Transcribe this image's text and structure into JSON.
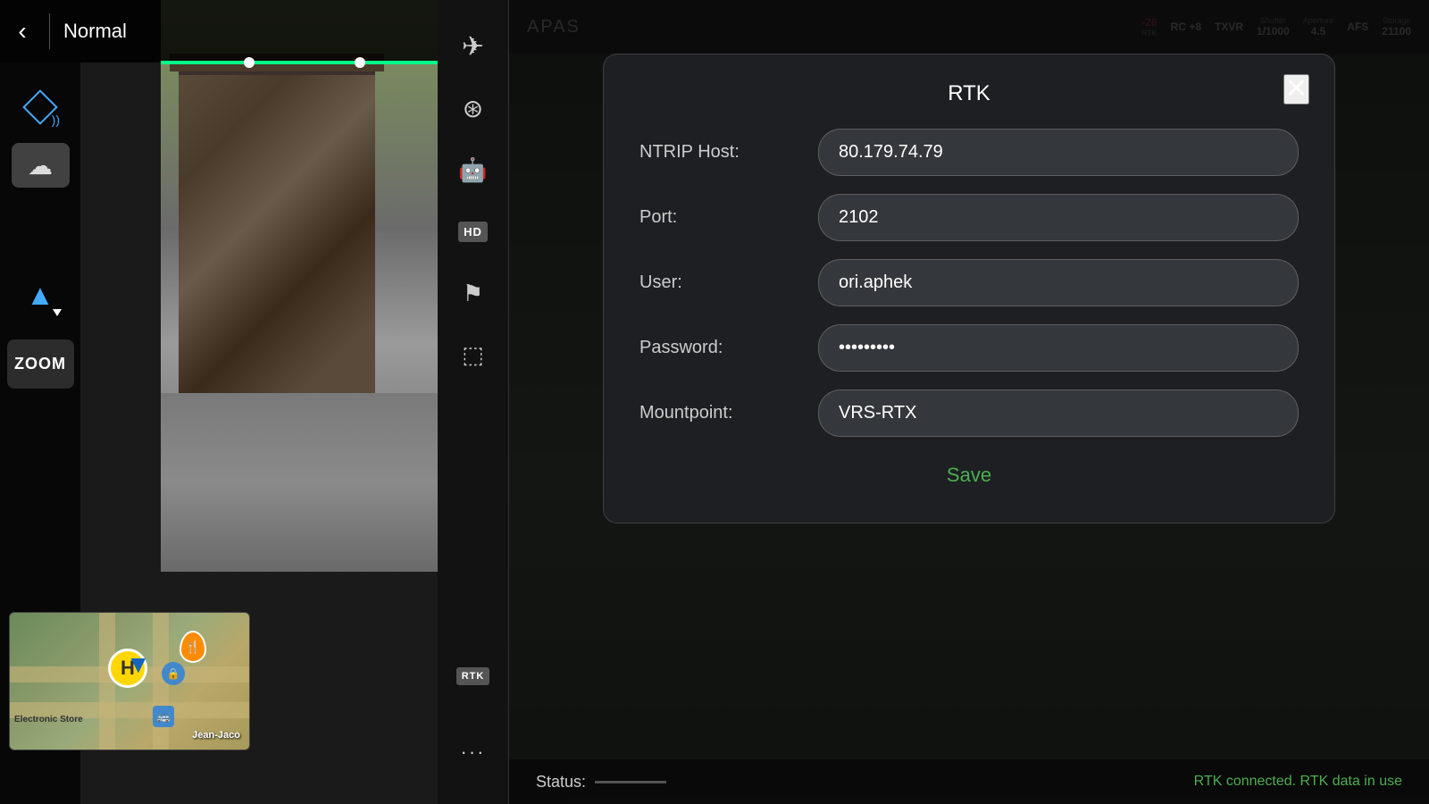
{
  "topbar": {
    "back_label": "‹",
    "mode_label": "Normal"
  },
  "sidebar_left": {
    "zoom_label": "ZOOM"
  },
  "apas_bar": {
    "apas_label": "APAS"
  },
  "top_status": {
    "items": [
      {
        "label": "RTK",
        "value": "-28",
        "color": "red"
      },
      {
        "label": "RC",
        "value": "+8",
        "color": "normal"
      },
      {
        "label": "TXVR",
        "value": "",
        "color": "normal"
      },
      {
        "label": "Shutter",
        "value": "1/1000",
        "color": "normal"
      },
      {
        "label": "Aperture",
        "value": "4.5",
        "color": "normal"
      },
      {
        "label": "AFS",
        "value": "",
        "color": "normal"
      },
      {
        "label": "Storage",
        "value": "21100",
        "color": "normal"
      }
    ]
  },
  "rtk_modal": {
    "title": "RTK",
    "close_label": "✕",
    "fields": [
      {
        "label": "NTRIP Host:",
        "value": "80.179.74.79",
        "type": "text",
        "name": "ntrip-host"
      },
      {
        "label": "Port:",
        "value": "2102",
        "type": "text",
        "name": "port"
      },
      {
        "label": "User:",
        "value": "ori.aphek",
        "type": "text",
        "name": "user"
      },
      {
        "label": "Password:",
        "value": "········",
        "type": "password",
        "name": "password"
      },
      {
        "label": "Mountpoint:",
        "value": "VRS-RTX",
        "type": "text",
        "name": "mountpoint"
      }
    ],
    "save_label": "Save"
  },
  "status_bar": {
    "label": "Status:",
    "connected_text": "RTK connected. RTK data in use"
  },
  "map": {
    "label1": "Electronic Store",
    "label2": "Jean-Jaco"
  },
  "icons": {
    "drone": "✈",
    "compass": "⊙",
    "robot": "⚙",
    "hd": "HD",
    "flag": "⚑",
    "camera": "📷",
    "rtk": "RTK",
    "dots": "···"
  }
}
